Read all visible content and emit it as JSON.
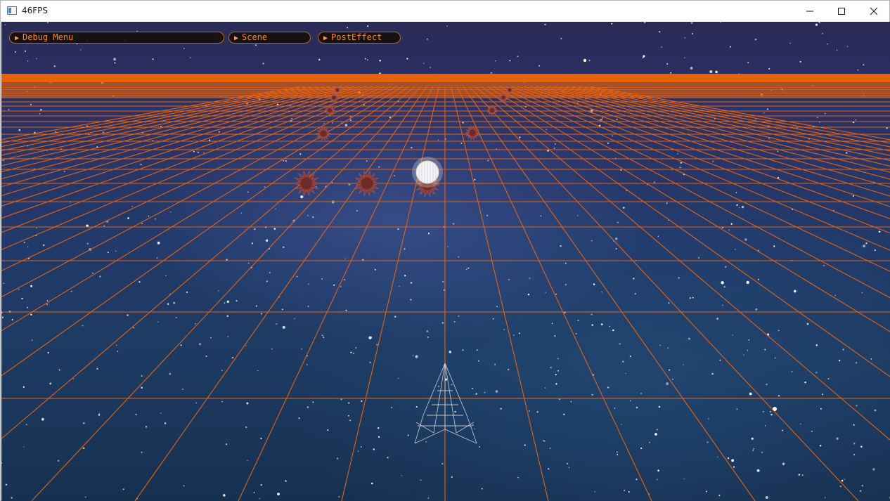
{
  "window": {
    "title": "46FPS",
    "controls": {
      "minimize": "—",
      "maximize": "☐",
      "close": "✕"
    }
  },
  "menus": {
    "debug_menu": "Debug Menu",
    "scene": "Scene",
    "post_effect": "PostEffect",
    "arrow": "▶"
  },
  "scene": {
    "grid_color": "#e8620c",
    "horizon_color": "#e8620c",
    "player_ship": "wireframe-ship",
    "projectile": "white-orb",
    "enemy_count": 10
  }
}
